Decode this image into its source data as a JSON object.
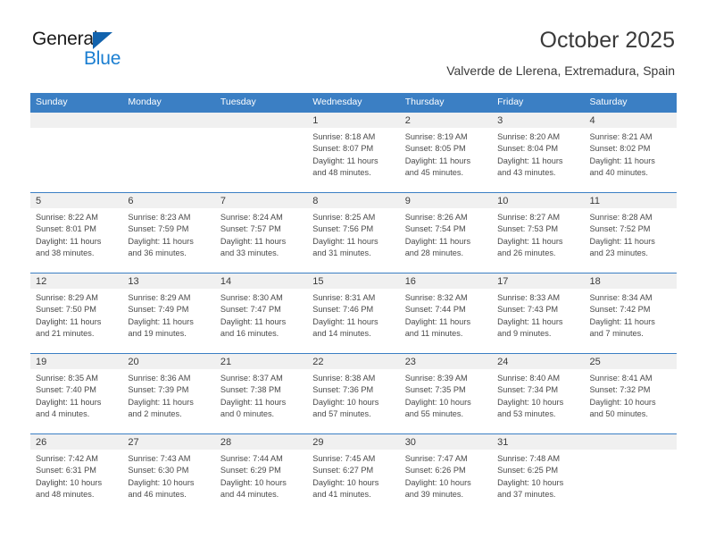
{
  "brand": {
    "name_part1": "General",
    "name_part2": "Blue",
    "logo_icon": "triangle-flag-icon",
    "accent_color": "#1263ad",
    "blue_text_color": "#1a7ed1"
  },
  "header": {
    "title": "October 2025",
    "subtitle": "Valverde de Llerena, Extremadura, Spain"
  },
  "calendar": {
    "header_background": "#3b7fc4",
    "daynum_background": "#f0f0f0",
    "weekdays": [
      "Sunday",
      "Monday",
      "Tuesday",
      "Wednesday",
      "Thursday",
      "Friday",
      "Saturday"
    ],
    "weeks": [
      [
        {
          "day": "",
          "empty": true,
          "sunrise": "",
          "sunset": "",
          "daylight_line1": "",
          "daylight_line2": ""
        },
        {
          "day": "",
          "empty": true,
          "sunrise": "",
          "sunset": "",
          "daylight_line1": "",
          "daylight_line2": ""
        },
        {
          "day": "",
          "empty": true,
          "sunrise": "",
          "sunset": "",
          "daylight_line1": "",
          "daylight_line2": ""
        },
        {
          "day": "1",
          "empty": false,
          "sunrise": "Sunrise: 8:18 AM",
          "sunset": "Sunset: 8:07 PM",
          "daylight_line1": "Daylight: 11 hours",
          "daylight_line2": "and 48 minutes."
        },
        {
          "day": "2",
          "empty": false,
          "sunrise": "Sunrise: 8:19 AM",
          "sunset": "Sunset: 8:05 PM",
          "daylight_line1": "Daylight: 11 hours",
          "daylight_line2": "and 45 minutes."
        },
        {
          "day": "3",
          "empty": false,
          "sunrise": "Sunrise: 8:20 AM",
          "sunset": "Sunset: 8:04 PM",
          "daylight_line1": "Daylight: 11 hours",
          "daylight_line2": "and 43 minutes."
        },
        {
          "day": "4",
          "empty": false,
          "sunrise": "Sunrise: 8:21 AM",
          "sunset": "Sunset: 8:02 PM",
          "daylight_line1": "Daylight: 11 hours",
          "daylight_line2": "and 40 minutes."
        }
      ],
      [
        {
          "day": "5",
          "empty": false,
          "sunrise": "Sunrise: 8:22 AM",
          "sunset": "Sunset: 8:01 PM",
          "daylight_line1": "Daylight: 11 hours",
          "daylight_line2": "and 38 minutes."
        },
        {
          "day": "6",
          "empty": false,
          "sunrise": "Sunrise: 8:23 AM",
          "sunset": "Sunset: 7:59 PM",
          "daylight_line1": "Daylight: 11 hours",
          "daylight_line2": "and 36 minutes."
        },
        {
          "day": "7",
          "empty": false,
          "sunrise": "Sunrise: 8:24 AM",
          "sunset": "Sunset: 7:57 PM",
          "daylight_line1": "Daylight: 11 hours",
          "daylight_line2": "and 33 minutes."
        },
        {
          "day": "8",
          "empty": false,
          "sunrise": "Sunrise: 8:25 AM",
          "sunset": "Sunset: 7:56 PM",
          "daylight_line1": "Daylight: 11 hours",
          "daylight_line2": "and 31 minutes."
        },
        {
          "day": "9",
          "empty": false,
          "sunrise": "Sunrise: 8:26 AM",
          "sunset": "Sunset: 7:54 PM",
          "daylight_line1": "Daylight: 11 hours",
          "daylight_line2": "and 28 minutes."
        },
        {
          "day": "10",
          "empty": false,
          "sunrise": "Sunrise: 8:27 AM",
          "sunset": "Sunset: 7:53 PM",
          "daylight_line1": "Daylight: 11 hours",
          "daylight_line2": "and 26 minutes."
        },
        {
          "day": "11",
          "empty": false,
          "sunrise": "Sunrise: 8:28 AM",
          "sunset": "Sunset: 7:52 PM",
          "daylight_line1": "Daylight: 11 hours",
          "daylight_line2": "and 23 minutes."
        }
      ],
      [
        {
          "day": "12",
          "empty": false,
          "sunrise": "Sunrise: 8:29 AM",
          "sunset": "Sunset: 7:50 PM",
          "daylight_line1": "Daylight: 11 hours",
          "daylight_line2": "and 21 minutes."
        },
        {
          "day": "13",
          "empty": false,
          "sunrise": "Sunrise: 8:29 AM",
          "sunset": "Sunset: 7:49 PM",
          "daylight_line1": "Daylight: 11 hours",
          "daylight_line2": "and 19 minutes."
        },
        {
          "day": "14",
          "empty": false,
          "sunrise": "Sunrise: 8:30 AM",
          "sunset": "Sunset: 7:47 PM",
          "daylight_line1": "Daylight: 11 hours",
          "daylight_line2": "and 16 minutes."
        },
        {
          "day": "15",
          "empty": false,
          "sunrise": "Sunrise: 8:31 AM",
          "sunset": "Sunset: 7:46 PM",
          "daylight_line1": "Daylight: 11 hours",
          "daylight_line2": "and 14 minutes."
        },
        {
          "day": "16",
          "empty": false,
          "sunrise": "Sunrise: 8:32 AM",
          "sunset": "Sunset: 7:44 PM",
          "daylight_line1": "Daylight: 11 hours",
          "daylight_line2": "and 11 minutes."
        },
        {
          "day": "17",
          "empty": false,
          "sunrise": "Sunrise: 8:33 AM",
          "sunset": "Sunset: 7:43 PM",
          "daylight_line1": "Daylight: 11 hours",
          "daylight_line2": "and 9 minutes."
        },
        {
          "day": "18",
          "empty": false,
          "sunrise": "Sunrise: 8:34 AM",
          "sunset": "Sunset: 7:42 PM",
          "daylight_line1": "Daylight: 11 hours",
          "daylight_line2": "and 7 minutes."
        }
      ],
      [
        {
          "day": "19",
          "empty": false,
          "sunrise": "Sunrise: 8:35 AM",
          "sunset": "Sunset: 7:40 PM",
          "daylight_line1": "Daylight: 11 hours",
          "daylight_line2": "and 4 minutes."
        },
        {
          "day": "20",
          "empty": false,
          "sunrise": "Sunrise: 8:36 AM",
          "sunset": "Sunset: 7:39 PM",
          "daylight_line1": "Daylight: 11 hours",
          "daylight_line2": "and 2 minutes."
        },
        {
          "day": "21",
          "empty": false,
          "sunrise": "Sunrise: 8:37 AM",
          "sunset": "Sunset: 7:38 PM",
          "daylight_line1": "Daylight: 11 hours",
          "daylight_line2": "and 0 minutes."
        },
        {
          "day": "22",
          "empty": false,
          "sunrise": "Sunrise: 8:38 AM",
          "sunset": "Sunset: 7:36 PM",
          "daylight_line1": "Daylight: 10 hours",
          "daylight_line2": "and 57 minutes."
        },
        {
          "day": "23",
          "empty": false,
          "sunrise": "Sunrise: 8:39 AM",
          "sunset": "Sunset: 7:35 PM",
          "daylight_line1": "Daylight: 10 hours",
          "daylight_line2": "and 55 minutes."
        },
        {
          "day": "24",
          "empty": false,
          "sunrise": "Sunrise: 8:40 AM",
          "sunset": "Sunset: 7:34 PM",
          "daylight_line1": "Daylight: 10 hours",
          "daylight_line2": "and 53 minutes."
        },
        {
          "day": "25",
          "empty": false,
          "sunrise": "Sunrise: 8:41 AM",
          "sunset": "Sunset: 7:32 PM",
          "daylight_line1": "Daylight: 10 hours",
          "daylight_line2": "and 50 minutes."
        }
      ],
      [
        {
          "day": "26",
          "empty": false,
          "sunrise": "Sunrise: 7:42 AM",
          "sunset": "Sunset: 6:31 PM",
          "daylight_line1": "Daylight: 10 hours",
          "daylight_line2": "and 48 minutes."
        },
        {
          "day": "27",
          "empty": false,
          "sunrise": "Sunrise: 7:43 AM",
          "sunset": "Sunset: 6:30 PM",
          "daylight_line1": "Daylight: 10 hours",
          "daylight_line2": "and 46 minutes."
        },
        {
          "day": "28",
          "empty": false,
          "sunrise": "Sunrise: 7:44 AM",
          "sunset": "Sunset: 6:29 PM",
          "daylight_line1": "Daylight: 10 hours",
          "daylight_line2": "and 44 minutes."
        },
        {
          "day": "29",
          "empty": false,
          "sunrise": "Sunrise: 7:45 AM",
          "sunset": "Sunset: 6:27 PM",
          "daylight_line1": "Daylight: 10 hours",
          "daylight_line2": "and 41 minutes."
        },
        {
          "day": "30",
          "empty": false,
          "sunrise": "Sunrise: 7:47 AM",
          "sunset": "Sunset: 6:26 PM",
          "daylight_line1": "Daylight: 10 hours",
          "daylight_line2": "and 39 minutes."
        },
        {
          "day": "31",
          "empty": false,
          "sunrise": "Sunrise: 7:48 AM",
          "sunset": "Sunset: 6:25 PM",
          "daylight_line1": "Daylight: 10 hours",
          "daylight_line2": "and 37 minutes."
        },
        {
          "day": "",
          "empty": true,
          "sunrise": "",
          "sunset": "",
          "daylight_line1": "",
          "daylight_line2": ""
        }
      ]
    ]
  }
}
